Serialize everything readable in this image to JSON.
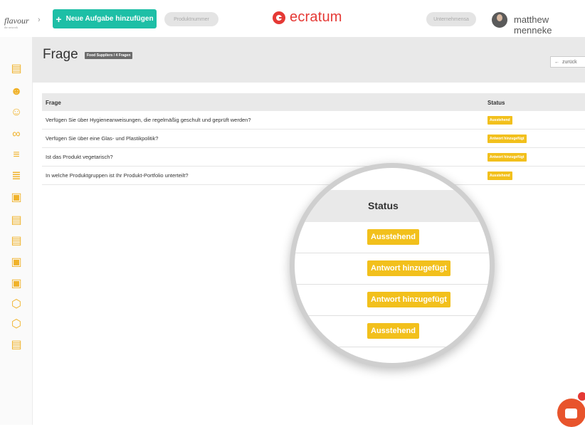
{
  "topbar": {
    "logo_text": "flavour",
    "logo_sub": "the network",
    "new_task_label": "Neue Aufgabe hinzufügen",
    "product_number_placeholder": "Produktnummer",
    "brand_name": "ecratum",
    "company_placeholder": "Unternehmensa",
    "username": "matthew menneke"
  },
  "sidebar": {
    "icons": [
      "monitor-icon",
      "user-star-icon",
      "user-search-icon",
      "users-icon",
      "list-icon",
      "tree-list-icon",
      "chat-icon",
      "document-icon",
      "document-check-icon",
      "box-icon",
      "box-star-icon",
      "settings-icon",
      "settings-alt-icon",
      "report-icon"
    ]
  },
  "page": {
    "title": "Frage",
    "breadcrumb": "Food Suppliers / 4 Fragen",
    "back_label": "zurück"
  },
  "table": {
    "columns": [
      "Frage",
      "Status"
    ],
    "rows": [
      {
        "question": "Verfügen Sie über Hygieneanweisungen, die regelmäßig geschult und geprüft werden?",
        "status": "Ausstehend"
      },
      {
        "question": "Verfügen Sie über eine Glas- und Plastikpolitik?",
        "status": "Antwort hinzugefügt"
      },
      {
        "question": "Ist das Produkt vegetarisch?",
        "status": "Antwort hinzugefügt"
      },
      {
        "question": "In welche Produktgruppen ist Ihr Produkt-Portfolio unterteilt?",
        "status": "Ausstehend"
      }
    ]
  },
  "magnifier": {
    "header": "Status",
    "badges": [
      "Ausstehend",
      "Antwort hinzugefügt",
      "Antwort hinzugefügt",
      "Ausstehend"
    ]
  },
  "colors": {
    "accent": "#1dbfa6",
    "brand": "#e53935",
    "badge": "#f2c01c",
    "sidebar_icon": "#f0b22a"
  }
}
